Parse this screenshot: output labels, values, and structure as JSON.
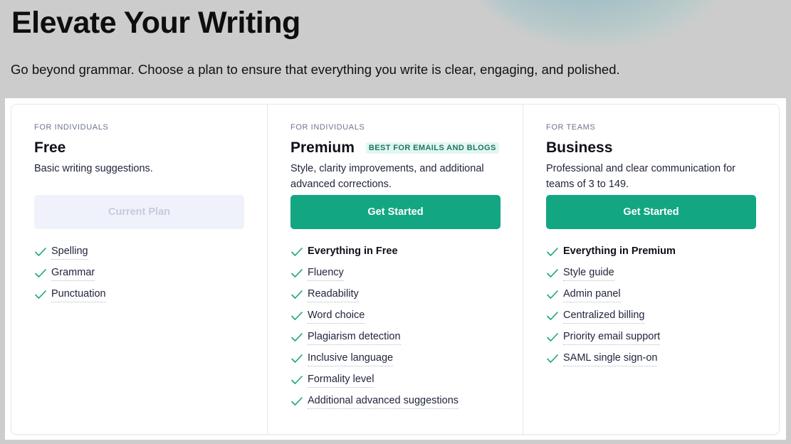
{
  "page": {
    "title": "Elevate Your Writing",
    "subtitle": "Go beyond grammar. Choose a plan to ensure that everything you write is clear, engaging, and polished."
  },
  "colors": {
    "accent": "#13a683",
    "badge_bg": "#e1f7f0",
    "badge_text": "#207563",
    "disabled_bg": "#f0f2fb",
    "check": "#13a683"
  },
  "plans": [
    {
      "eyebrow": "FOR INDIVIDUALS",
      "name": "Free",
      "badge": null,
      "description": "Basic writing suggestions.",
      "cta": "Current Plan",
      "cta_state": "disabled",
      "features": [
        {
          "label": "Spelling",
          "icon": "check-icon"
        },
        {
          "label": "Grammar",
          "icon": "check-icon"
        },
        {
          "label": "Punctuation",
          "icon": "check-icon"
        }
      ]
    },
    {
      "eyebrow": "FOR INDIVIDUALS",
      "name": "Premium",
      "badge": "BEST FOR EMAILS AND BLOGS",
      "description": "Style, clarity improvements, and additional advanced corrections.",
      "cta": "Get Started",
      "cta_state": "primary",
      "features": [
        {
          "label": "Everything in Free",
          "icon": "check-icon",
          "strong": true
        },
        {
          "label": "Fluency",
          "icon": "check-icon"
        },
        {
          "label": "Readability",
          "icon": "check-icon"
        },
        {
          "label": "Word choice",
          "icon": "check-icon"
        },
        {
          "label": "Plagiarism detection",
          "icon": "check-icon"
        },
        {
          "label": "Inclusive language",
          "icon": "check-icon"
        },
        {
          "label": "Formality level",
          "icon": "check-icon"
        },
        {
          "label": "Additional advanced suggestions",
          "icon": "check-icon"
        }
      ]
    },
    {
      "eyebrow": "FOR TEAMS",
      "name": "Business",
      "badge": null,
      "description": "Professional and clear communication for teams of 3 to 149.",
      "cta": "Get Started",
      "cta_state": "primary",
      "features": [
        {
          "label": "Everything in Premium",
          "icon": "check-icon",
          "strong": true
        },
        {
          "label": "Style guide",
          "icon": "check-icon"
        },
        {
          "label": "Admin panel",
          "icon": "check-icon"
        },
        {
          "label": "Centralized billing",
          "icon": "check-icon"
        },
        {
          "label": "Priority email support",
          "icon": "check-icon"
        },
        {
          "label": "SAML single sign-on",
          "icon": "check-icon"
        }
      ]
    }
  ]
}
